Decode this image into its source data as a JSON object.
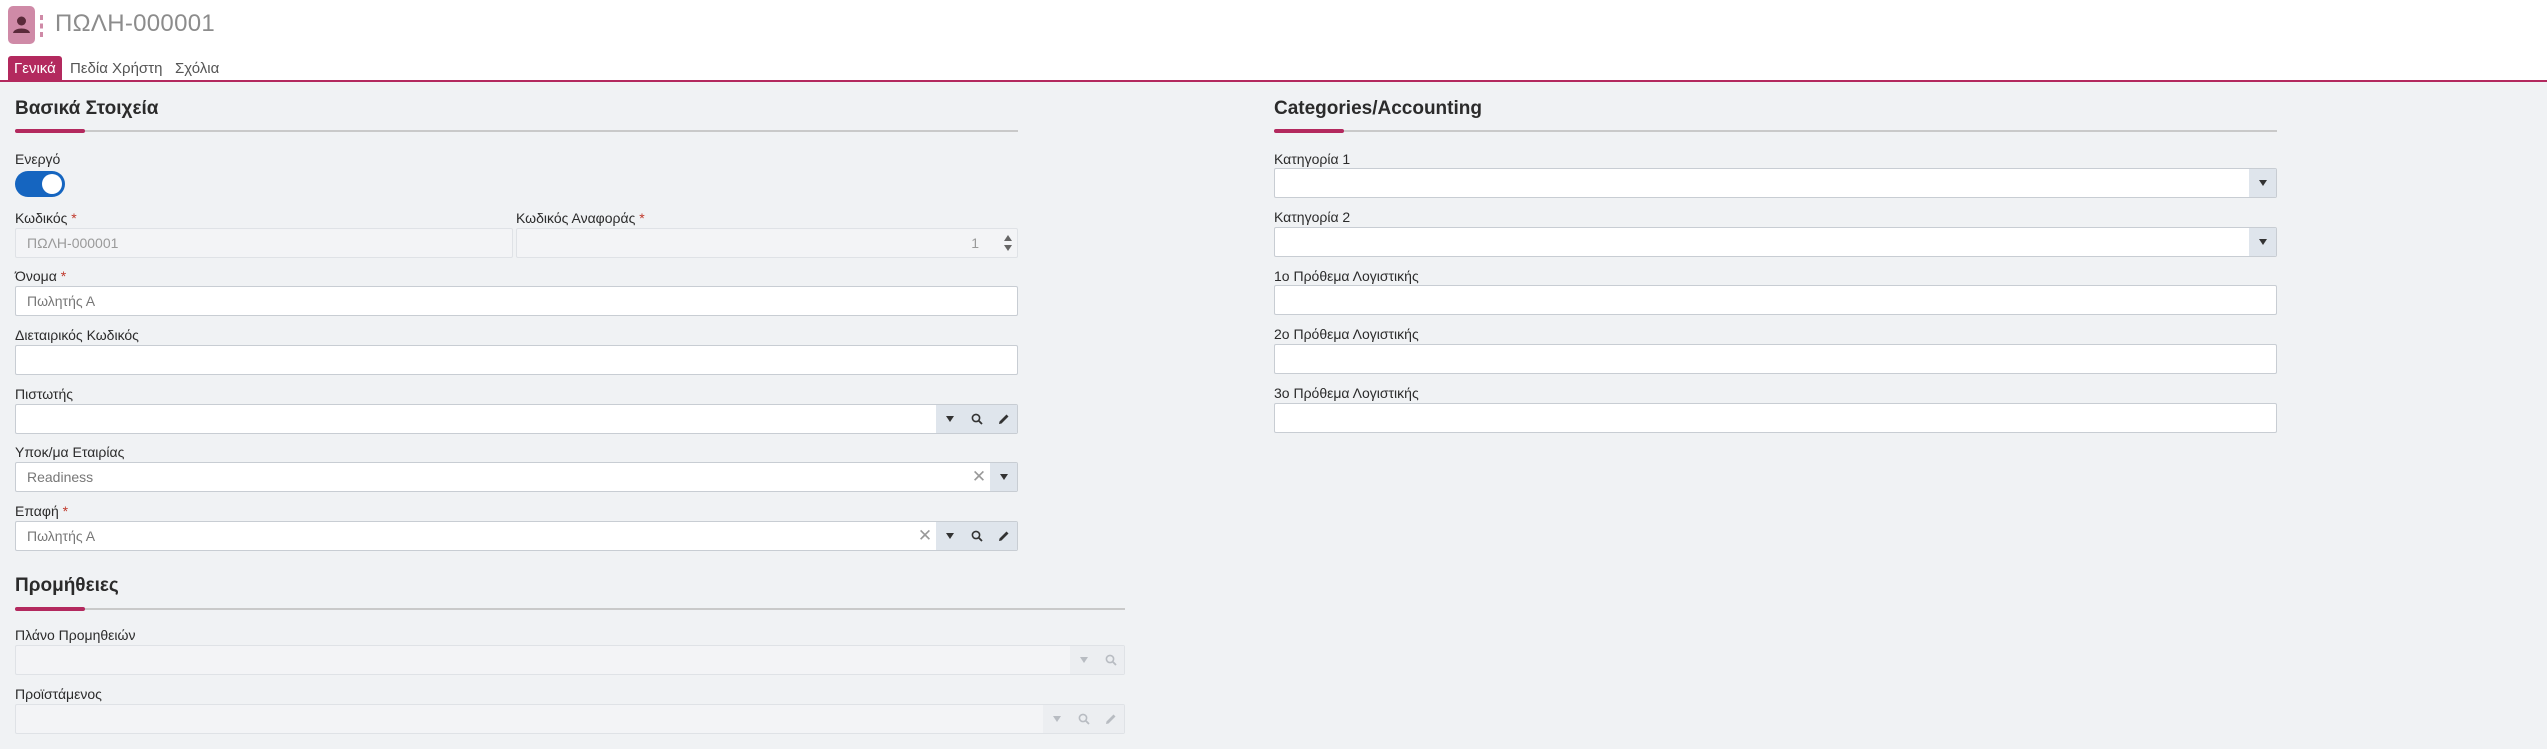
{
  "header": {
    "title": "ΠΩΛΗ-000001"
  },
  "tabs": [
    {
      "label": "Γενικά"
    },
    {
      "label": "Πεδία Χρήστη"
    },
    {
      "label": "Σχόλια"
    }
  ],
  "basic": {
    "title": "Βασικά Στοιχεία",
    "active_label": "Ενεργό",
    "active_value": true,
    "code_label": "Κωδικός",
    "code_value": "ΠΩΛΗ-000001",
    "ref_code_label": "Κωδικός Αναφοράς",
    "ref_code_value": "1",
    "name_label": "Όνομα",
    "name_value": "Πωλητής Α",
    "mgmt_code_label": "Διεταιρικός Κωδικός",
    "mgmt_code_value": "",
    "creditor_label": "Πιστωτής",
    "creditor_value": "",
    "branch_label": "Υποκ/μα Εταιρίας",
    "branch_value": "Readiness",
    "contact_label": "Επαφή",
    "contact_value": "Πωλητής Α",
    "required_mark": "*"
  },
  "commissions": {
    "title": "Προμήθειες",
    "plan_label": "Πλάνο Προμηθειών",
    "plan_value": "",
    "supervisor_label": "Προϊστάμενος",
    "supervisor_value": ""
  },
  "accounting": {
    "title": "Categories/Accounting",
    "cat1_label": "Κατηγορία 1",
    "cat1_value": "",
    "cat2_label": "Κατηγορία 2",
    "cat2_value": "",
    "prefix1_label": "1ο Πρόθεμα Λογιστικής",
    "prefix1_value": "",
    "prefix2_label": "2ο Πρόθεμα Λογιστικής",
    "prefix2_value": "",
    "prefix3_label": "3ο Πρόθεμα Λογιστικής",
    "prefix3_value": ""
  },
  "colors": {
    "accent": "#b3295e",
    "toggle_on": "#1565c0",
    "panel_bg": "#f0f2f4"
  }
}
